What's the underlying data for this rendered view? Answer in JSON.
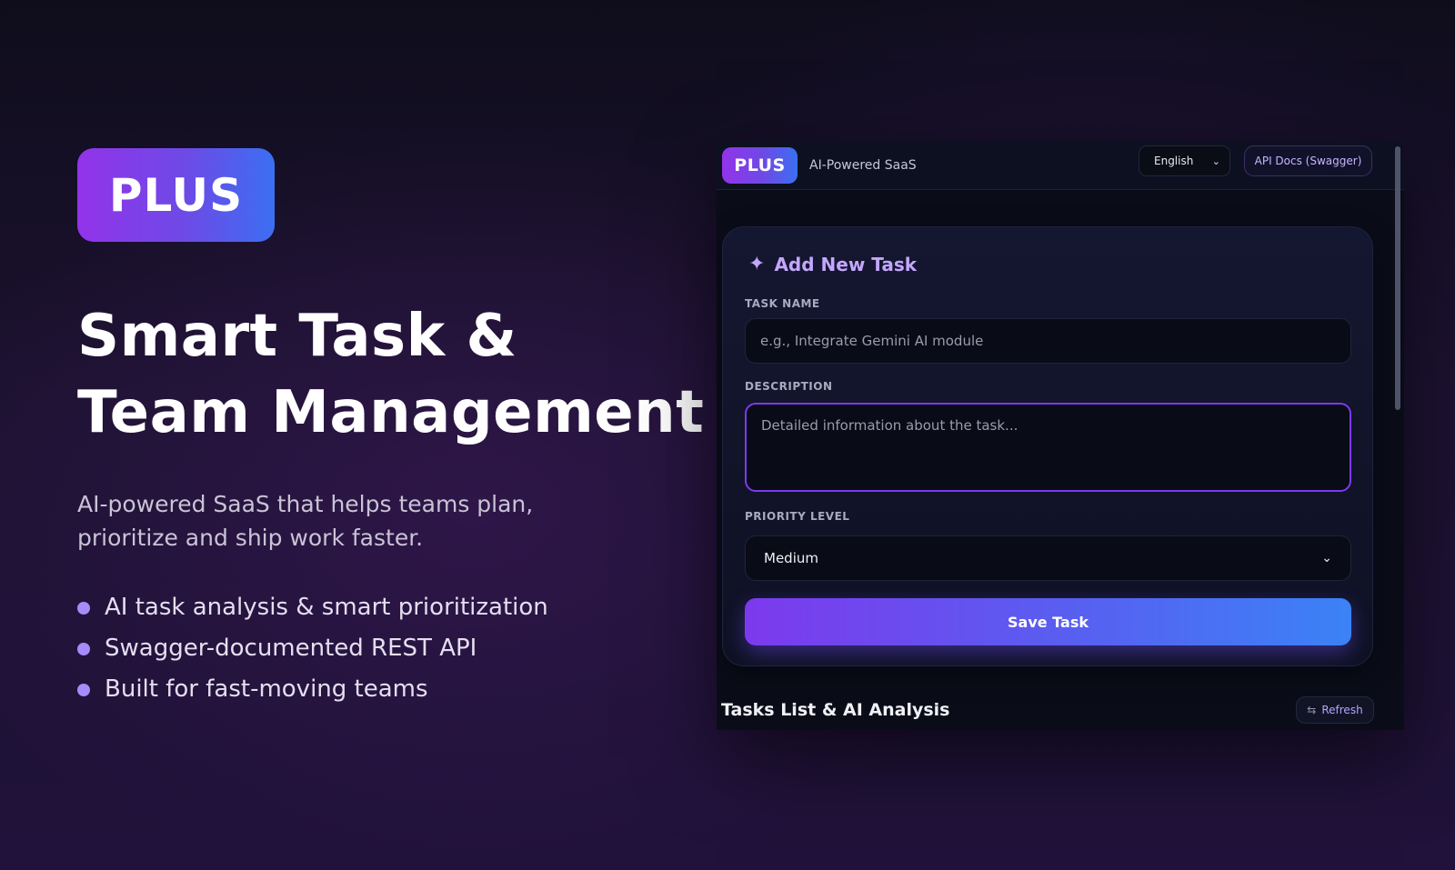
{
  "hero": {
    "logo": "PLUS",
    "title_line1": "Smart Task &",
    "title_line2": "Team Management",
    "subtitle": "AI-powered SaaS that helps teams plan, prioritize and ship work faster.",
    "features": [
      "AI task analysis & smart prioritization",
      "Swagger-documented REST API",
      "Built for fast-moving teams"
    ]
  },
  "app": {
    "header": {
      "logo": "PLUS",
      "tagline": "AI-Powered SaaS",
      "language": "English",
      "api_docs": "API Docs (Swagger)"
    },
    "form": {
      "title": "Add New Task",
      "task_name_label": "TASK NAME",
      "task_name_placeholder": "e.g., Integrate Gemini AI module",
      "description_label": "DESCRIPTION",
      "description_placeholder": "Detailed information about the task...",
      "priority_label": "PRIORITY LEVEL",
      "priority_value": "Medium",
      "save_label": "Save Task"
    },
    "tasks": {
      "title": "Tasks List & AI Analysis",
      "refresh_label": "Refresh"
    }
  },
  "colors": {
    "accent_purple": "#7c3aed",
    "accent_blue": "#3b82f6",
    "bullet": "#a78bfa"
  },
  "icons": {
    "sparkle": "sparkle-icon",
    "chevron": "chevron-down-icon",
    "refresh": "refresh-icon"
  }
}
